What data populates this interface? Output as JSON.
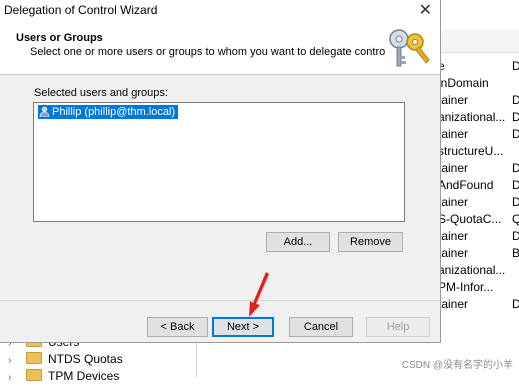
{
  "dialog": {
    "title": "Delegation of Control Wizard",
    "header_title": "Users or Groups",
    "header_subtitle": "Select one or more users or groups to whom you want to delegate control.",
    "list_label": "Selected users and groups:",
    "selected_items": [
      "Phillip (phillip@thm.local)"
    ],
    "buttons": {
      "add": "Add...",
      "remove": "Remove",
      "back": "< Back",
      "next": "Next >",
      "cancel": "Cancel",
      "help": "Help"
    }
  },
  "background": {
    "rows": [
      {
        "name": "e",
        "type": "D"
      },
      {
        "name": "inDomain",
        "type": ""
      },
      {
        "name": "tainer",
        "type": "D"
      },
      {
        "name": "anizational...",
        "type": "D"
      },
      {
        "name": "tainer",
        "type": "D"
      },
      {
        "name": "structureU...",
        "type": ""
      },
      {
        "name": "tainer",
        "type": "D"
      },
      {
        "name": "AndFound",
        "type": "D"
      },
      {
        "name": "tainer",
        "type": "D"
      },
      {
        "name": "S-QuotaC...",
        "type": "Q"
      },
      {
        "name": "tainer",
        "type": "D"
      },
      {
        "name": "tainer",
        "type": "B"
      },
      {
        "name": "anizational...",
        "type": ""
      },
      {
        "name": "PM-Infor...",
        "type": ""
      },
      {
        "name": "tainer",
        "type": "D"
      }
    ],
    "tree_items": [
      "Users",
      "NTDS Quotas",
      "TPM Devices"
    ],
    "watermark": "CSDN @没有名字的小羊"
  },
  "icons": {
    "close": "close-icon",
    "keys": "keys-icon",
    "user": "user-icon",
    "folder": "folder-icon",
    "arrow": "red-arrow-annotation"
  },
  "colors": {
    "selection": "#0078d7",
    "annotation_arrow": "#e02020"
  }
}
